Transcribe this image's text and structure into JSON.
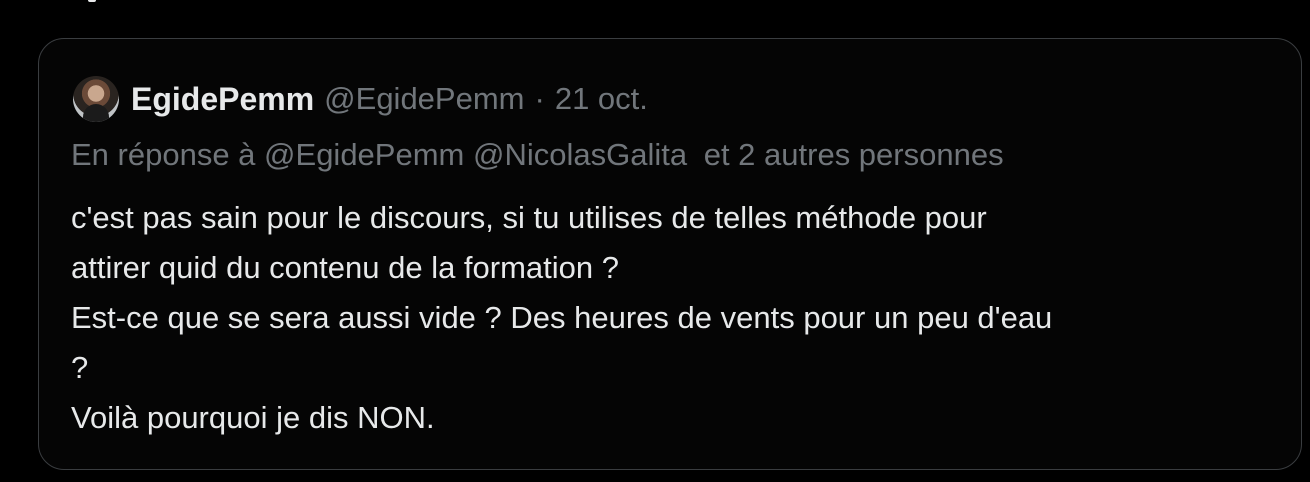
{
  "tweet": {
    "author": {
      "display_name": "EgidePemm",
      "handle": "@EgidePemm",
      "separator": "·",
      "date": "21 oct."
    },
    "reply_to": {
      "prefix": "En réponse à",
      "mention_1": "@EgidePemm",
      "mention_2": "@NicolasGalita",
      "suffix": "et 2 autres personnes"
    },
    "body_lines": [
      "c'est pas sain pour le discours, si tu utilises de telles méthode pour",
      "attirer quid du contenu de la formation ?",
      "Est-ce que se sera aussi vide ? Des heures de vents pour un peu d'eau",
      "?",
      "Voilà pourquoi je dis NON."
    ]
  },
  "theme": {
    "background": "#000000",
    "text_primary": "#e7e9ea",
    "text_secondary": "#71767b",
    "border": "#3a3d40"
  }
}
